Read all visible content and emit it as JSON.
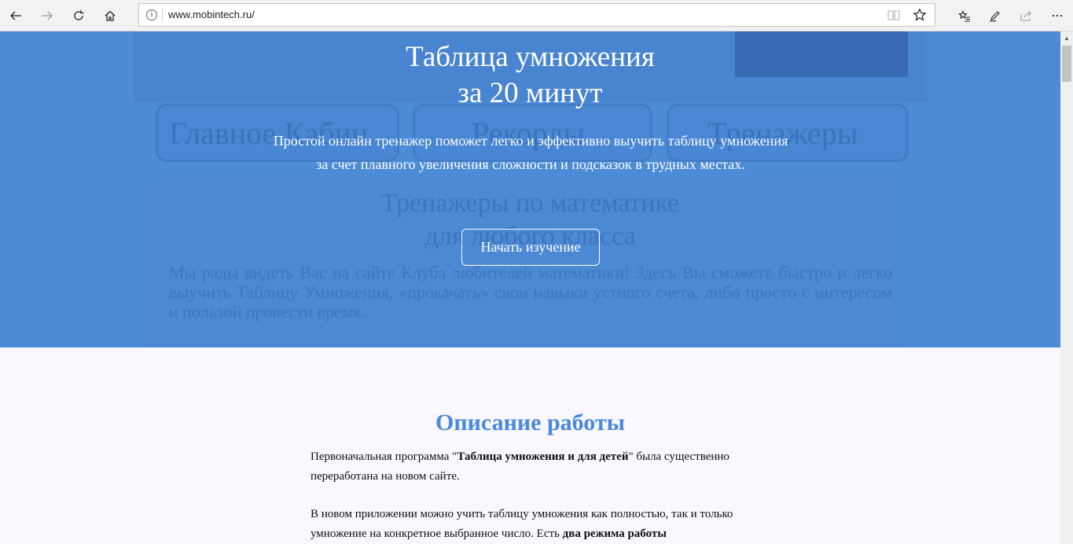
{
  "browser": {
    "url": "www.mobintech.ru/"
  },
  "hero": {
    "title_line1": "Таблица умножения",
    "title_line2": "за 20 минут",
    "description": "Простой онлайн тренажер поможет легко и эффективно выучить таблицу умножения за счет плавного увеличения сложности и подсказок в трудных местах.",
    "button_label": "Начать изучение",
    "background_color": "#4c8bd6",
    "ghost": {
      "menu_1": "Главное Кабин",
      "menu_2": "Рекорды",
      "menu_3": "Тренажеры",
      "heading_line1": "Тренажеры по математике",
      "heading_line2": "для любого класса",
      "text": "Мы рады видеть Вас на сайте Клуба любителей математики! Здесь Вы сможете быстро и легко выучить Таблицу Умножения, «прокачать» свои навыки устного счета, либо просто с интересом и пользой провести время."
    }
  },
  "content": {
    "section_title": "Описание работы",
    "p1_before": "Первоначальная программа \"",
    "p1_bold": "Таблица умножения и для детей",
    "p1_after": "\" была существенно переработана на новом сайте.",
    "p2_before": "В новом приложении можно учить таблицу умножения как полностью, так и только умножение на конкретное выбранное число. Есть ",
    "p2_bold": "два режима работы",
    "accent_color": "#4a89dc"
  }
}
